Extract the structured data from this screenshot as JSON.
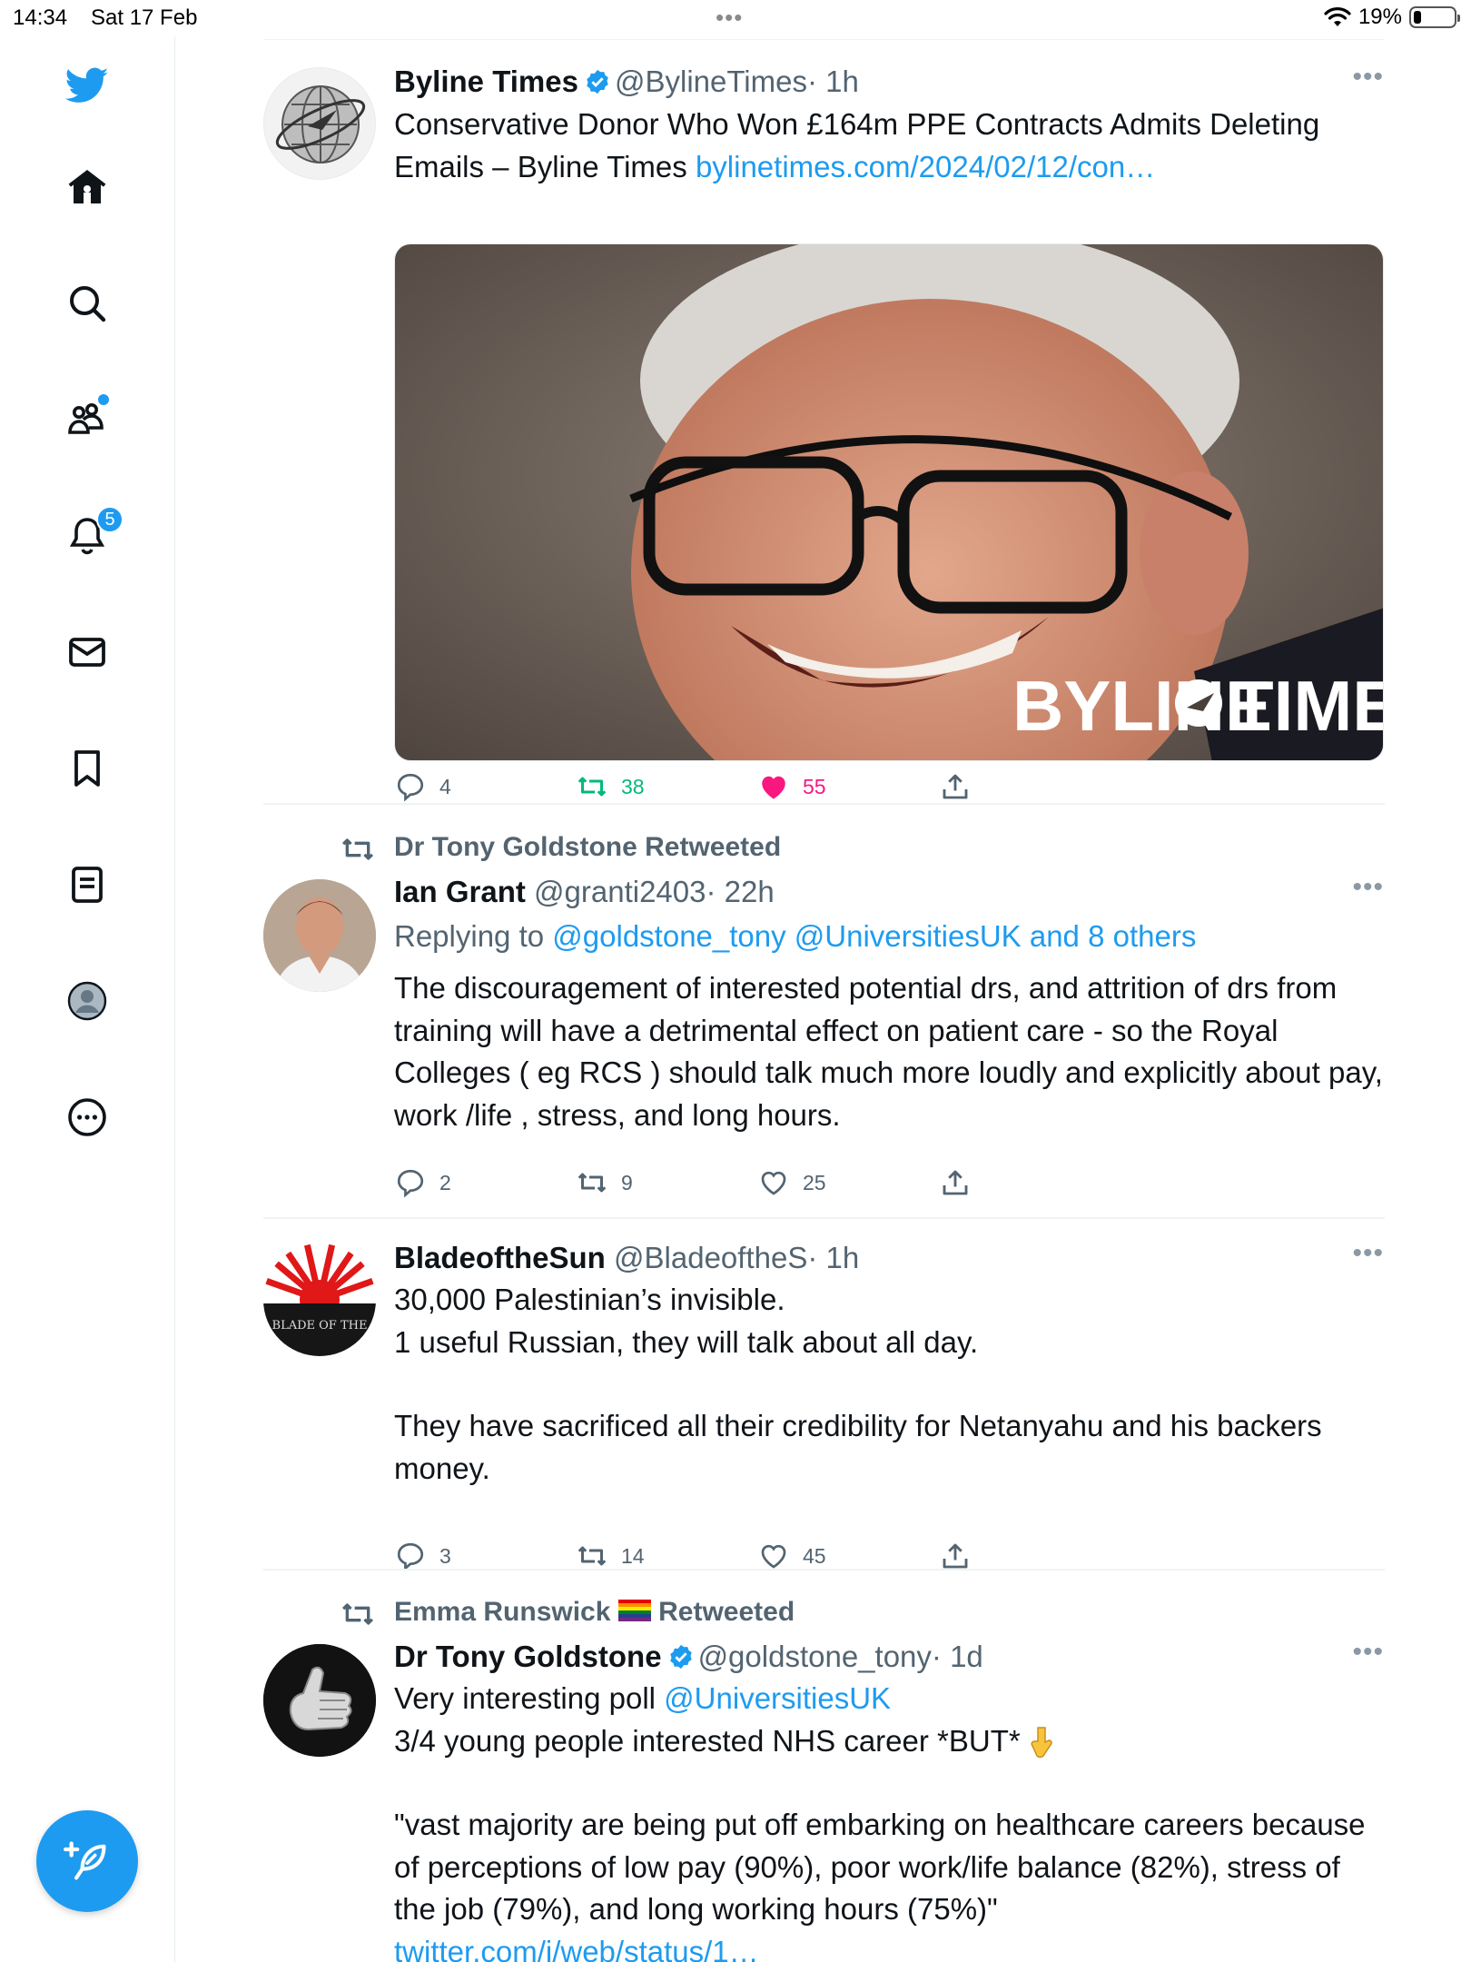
{
  "status_bar": {
    "time": "14:34",
    "date": "Sat 17 Feb",
    "battery": "19%",
    "battery_level": 0.19
  },
  "sidebar": {
    "items": [
      "twitter-logo",
      "home",
      "explore",
      "communities",
      "notifications",
      "messages",
      "bookmarks",
      "lists",
      "profile",
      "more"
    ],
    "notifications_badge": "5"
  },
  "colors": {
    "accent": "#1d9bf0",
    "retweet": "#00ba7c",
    "like": "#f91880",
    "secondary": "#536471"
  },
  "tweets": [
    {
      "name": "Byline Times",
      "handle": "@BylineTimes",
      "time": "· 1h",
      "text": "Conservative Donor Who Won £164m PPE Contracts Admits Deleting Emails – Byline Times",
      "link": "bylinetimes.com/2024/02/12/con…",
      "media_watermark": "BYLINE",
      "media_watermark2": "TIMES",
      "replies": "4",
      "retweets": "38",
      "likes": "55"
    },
    {
      "retweeted_by": "Dr Tony Goldstone Retweeted",
      "name": "Ian Grant",
      "handle": "@granti2403",
      "time": "· 22h",
      "replying_label": "Replying to",
      "replying_to": "@goldstone_tony @UniversitiesUK and 8 others",
      "text": "The discouragement of interested potential drs, and attrition of drs from training will have a detrimental effect on patient care - so the Royal Colleges ( eg RCS ) should talk much more loudly and explicitly about pay, work /life , stress, and long hours.",
      "replies": "2",
      "retweets": "9",
      "likes": "25"
    },
    {
      "name": "BladeoftheSun",
      "handle": "@BladeoftheS",
      "time": "· 1h",
      "avatar_text": "BLADE OF THE",
      "text_line1": "30,000 Palestinian’s invisible.",
      "text_line2": "1 useful Russian, they will talk about all day.",
      "text_line3": "They have sacrificed all their credibility for Netanyahu and his backers money.",
      "replies": "3",
      "retweets": "14",
      "likes": "45"
    },
    {
      "retweeted_by_name": "Emma Runswick",
      "retweeted_label": "Retweeted",
      "name": "Dr Tony Goldstone",
      "handle": "@goldstone_tony",
      "time": "· 1d",
      "text_start": "Very interesting poll",
      "mention": "@UniversitiesUK",
      "text_line2": "3/4 young people interested NHS career *BUT*",
      "text_quote": "\"vast majority are being put off embarking on healthcare careers because of perceptions of low pay (90%), poor work/life balance (82%), stress of the job (79%), and long working hours (75%)\"",
      "link": "twitter.com/i/web/status/1…"
    }
  ]
}
